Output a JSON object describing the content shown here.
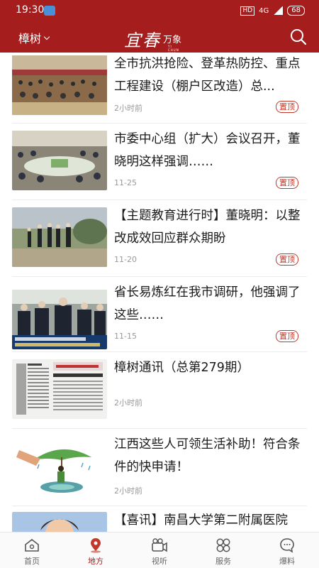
{
  "status_bar": {
    "time": "19:30",
    "network": "4G",
    "battery": "68"
  },
  "header": {
    "city": "樟树",
    "logo_main": "宜春",
    "logo_sub": "万象",
    "logo_tiny": "YI CHUN WAN XIANG"
  },
  "news": [
    {
      "title": "全市抗洪抢险、登革热防控、重点工程建设（棚户区改造）总...",
      "time": "2小时前",
      "tag": "置顶"
    },
    {
      "title": "市委中心组（扩大）会议召开，董晓明这样强调……",
      "time": "11-25",
      "tag": "置顶"
    },
    {
      "title": "【主题教育进行时】董晓明：以整改成效回应群众期盼",
      "time": "11-20",
      "tag": "置顶"
    },
    {
      "title": "省长易炼红在我市调研，他强调了这些……",
      "time": "11-15",
      "tag": "置顶"
    },
    {
      "title": "樟树通讯（总第279期）",
      "time": "2小时前",
      "tag": ""
    },
    {
      "title": "江西这些人可领生活补助！符合条件的快申请！",
      "time": "2小时前",
      "tag": ""
    },
    {
      "title": "【喜讯】南昌大学第二附属医院",
      "time": "",
      "tag": ""
    }
  ],
  "tabs": [
    {
      "label": "首页",
      "icon": "home-icon"
    },
    {
      "label": "地方",
      "icon": "location-pin-icon"
    },
    {
      "label": "视听",
      "icon": "video-camera-icon"
    },
    {
      "label": "服务",
      "icon": "services-grid-icon"
    },
    {
      "label": "爆料",
      "icon": "chat-bubble-icon"
    }
  ],
  "colors": {
    "brand": "#a51d1d",
    "tag": "#c0392b",
    "muted": "#999999"
  },
  "active_tab": "地方"
}
